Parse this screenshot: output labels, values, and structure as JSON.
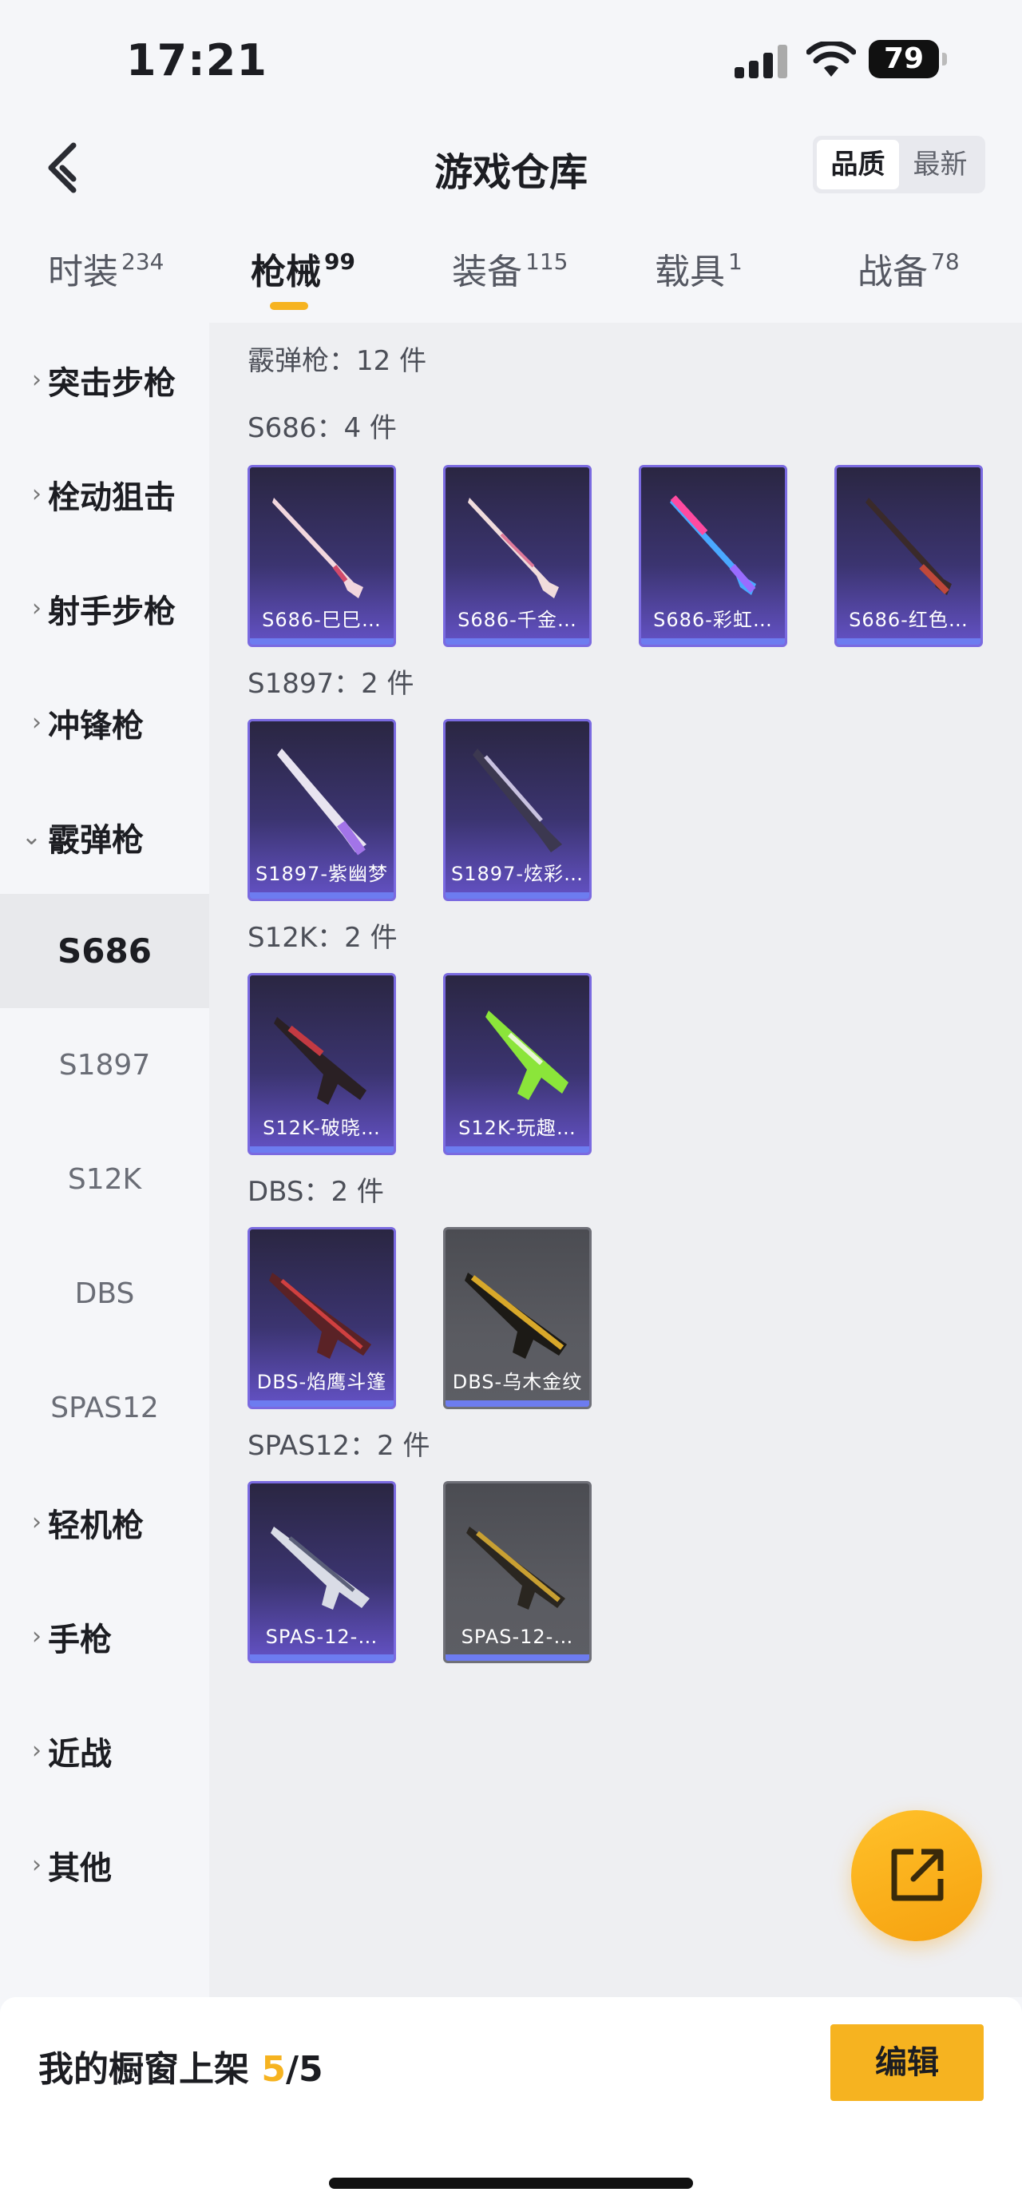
{
  "status": {
    "time": "17:21",
    "battery": "79"
  },
  "header": {
    "title": "游戏仓库",
    "sort_quality": "品质",
    "sort_newest": "最新"
  },
  "tabs": [
    {
      "label": "时装",
      "count": "234"
    },
    {
      "label": "枪械",
      "count": "99"
    },
    {
      "label": "装备",
      "count": "115"
    },
    {
      "label": "载具",
      "count": "1"
    },
    {
      "label": "战备",
      "count": "78"
    }
  ],
  "sidebar": {
    "items": [
      "突击步枪",
      "栓动狙击",
      "射手步枪",
      "冲锋枪",
      "霰弹枪",
      "轻机枪",
      "手枪",
      "近战",
      "其他"
    ],
    "subitems": [
      "S686",
      "S1897",
      "S12K",
      "DBS",
      "SPAS12"
    ]
  },
  "main": {
    "category_title": "霰弹枪：12 件",
    "groups": [
      {
        "title": "S686：4 件",
        "items": [
          "S686-巳巳…",
          "S686-千金…",
          "S686-彩虹…",
          "S686-红色…"
        ]
      },
      {
        "title": "S1897：2 件",
        "items": [
          "S1897-紫幽梦",
          "S1897-炫彩…"
        ]
      },
      {
        "title": "S12K：2 件",
        "items": [
          "S12K-破晓…",
          "S12K-玩趣…"
        ]
      },
      {
        "title": "DBS：2 件",
        "items": [
          "DBS-焰鹰斗篷",
          "DBS-乌木金纹"
        ]
      },
      {
        "title": "SPAS12：2 件",
        "items": [
          "SPAS-12-…",
          "SPAS-12-…"
        ]
      }
    ]
  },
  "bottom": {
    "label": "我的橱窗上架 ",
    "count": "5",
    "total": "/5",
    "edit": "编辑"
  },
  "icons": {
    "back": "chevron-left-icon",
    "fab": "share-external-icon",
    "expand": "chevron-right-icon"
  }
}
